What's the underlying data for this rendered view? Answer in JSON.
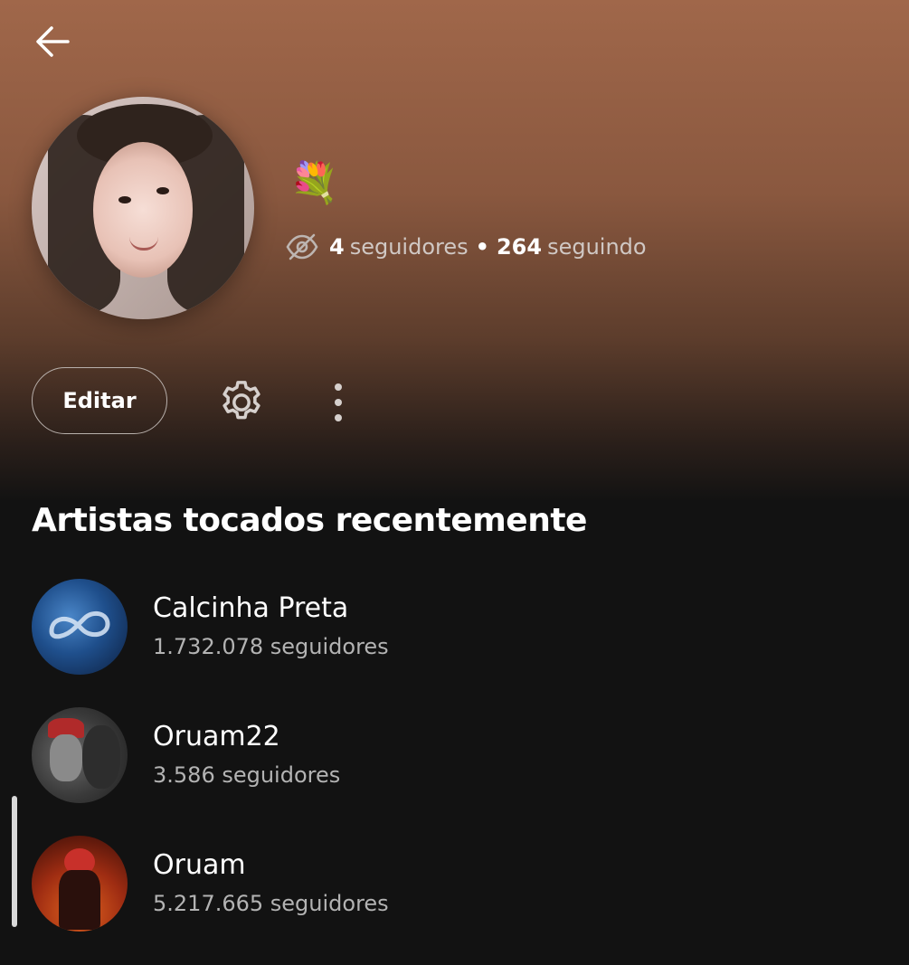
{
  "header": {
    "back_icon": "arrow-left-icon"
  },
  "profile": {
    "avatar_icon": "user-avatar",
    "emoji": "💐",
    "visibility_icon": "eye-off-icon",
    "followers_count": "4",
    "followers_label": "seguidores",
    "separator": "•",
    "following_count": "264",
    "following_label": "seguindo"
  },
  "actions": {
    "edit_label": "Editar",
    "settings_icon": "gear-icon",
    "more_icon": "more-vertical-icon"
  },
  "recent_artists": {
    "title": "Artistas tocados recentemente",
    "items": [
      {
        "name": "Calcinha Preta",
        "followers": "1.732.078 seguidores"
      },
      {
        "name": "Oruam22",
        "followers": "3.586 seguidores"
      },
      {
        "name": "Oruam",
        "followers": "5.217.665 seguidores"
      }
    ]
  },
  "colors": {
    "header_gradient_top": "#a0674a",
    "background": "#121212",
    "secondary_text": "#b3b3b3"
  }
}
